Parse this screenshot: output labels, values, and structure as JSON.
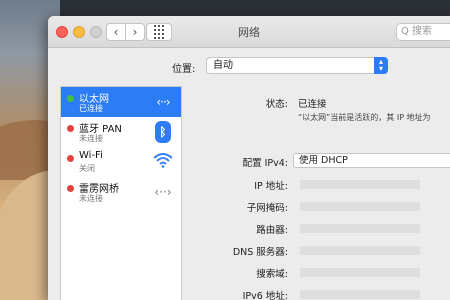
{
  "window": {
    "title": "网络",
    "search_placeholder": "Q 搜索"
  },
  "location": {
    "label": "位置:",
    "value": "自动"
  },
  "services": [
    {
      "name": "以太网",
      "status": "已连接",
      "dot": "green",
      "icon": "ethernet-icon",
      "selected": true
    },
    {
      "name": "蓝牙 PAN",
      "status": "未连接",
      "dot": "red",
      "icon": "bluetooth-icon",
      "selected": false
    },
    {
      "name": "Wi-Fi",
      "status": "关闭",
      "dot": "red",
      "icon": "wifi-icon",
      "selected": false
    },
    {
      "name": "雷雳网桥",
      "status": "未连接",
      "dot": "red",
      "icon": "thunderbolt-bridge-icon",
      "selected": false
    }
  ],
  "detail": {
    "status_label": "状态:",
    "status_value": "已连接",
    "status_note": "“以太网”当前是活跃的，其 IP 地址为",
    "config_label": "配置 IPv4:",
    "config_value": "使用 DHCP",
    "ip_label": "IP 地址:",
    "subnet_label": "子网掩码:",
    "router_label": "路由器:",
    "dns_label": "DNS 服务器:",
    "search_domain_label": "搜索域:",
    "ipv6_label": "IPv6 地址:"
  },
  "colors": {
    "accent": "#2c7cf6",
    "connected": "#3fbf3f",
    "disconnected": "#e2433d"
  }
}
